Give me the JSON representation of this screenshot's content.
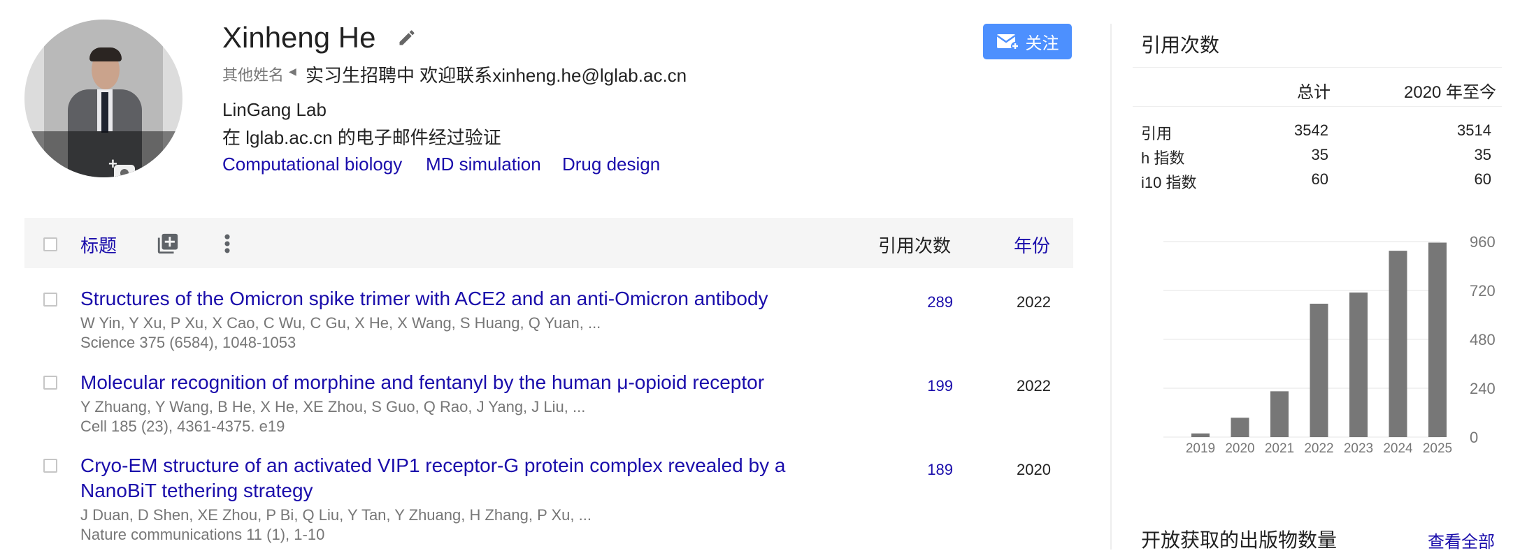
{
  "profile": {
    "name": "Xinheng He",
    "other_names_label": "其他姓名",
    "other_names_value": "实习生招聘中 欢迎联系xinheng.he@lglab.ac.cn",
    "affiliation": "LinGang Lab",
    "verified_email": "在 lglab.ac.cn 的电子邮件经过验证",
    "interests": [
      "Computational biology",
      "MD simulation",
      "Drug design"
    ],
    "follow_label": "关注"
  },
  "table": {
    "title_header": "标题",
    "cited_header": "引用次数",
    "year_header": "年份",
    "rows": [
      {
        "title_lines": [
          "Structures of the Omicron spike trimer with ACE2 and an anti-Omicron antibody"
        ],
        "authors": "W Yin, Y Xu, P Xu, X Cao, C Wu, C Gu, X He, X Wang, S Huang, Q Yuan, ...",
        "venue": "Science 375 (6584), 1048-1053",
        "cited": "289",
        "year": "2022"
      },
      {
        "title_lines": [
          "Molecular recognition of morphine and fentanyl by the human μ-opioid receptor"
        ],
        "authors": "Y Zhuang, Y Wang, B He, X He, XE Zhou, S Guo, Q Rao, J Yang, J Liu, ...",
        "venue": "Cell 185 (23), 4361-4375. e19",
        "cited": "199",
        "year": "2022"
      },
      {
        "title_lines": [
          "Cryo-EM structure of an activated VIP1 receptor-G protein complex revealed by a",
          "NanoBiT tethering strategy"
        ],
        "authors": "J Duan, D Shen, XE Zhou, P Bi, Q Liu, Y Tan, Y Zhuang, H Zhang, P Xu, ...",
        "venue": "Nature communications 11 (1), 1-10",
        "cited": "189",
        "year": "2020"
      }
    ]
  },
  "citations": {
    "title": "引用次数",
    "col_total": "总计",
    "col_since": "2020 年至今",
    "metrics": [
      {
        "label": "引用",
        "total": "3542",
        "since": "3514"
      },
      {
        "label": "h 指数",
        "total": "35",
        "since": "35"
      },
      {
        "label": "i10 指数",
        "total": "60",
        "since": "60"
      }
    ]
  },
  "chart_data": {
    "type": "bar",
    "categories": [
      "2019",
      "2020",
      "2021",
      "2022",
      "2023",
      "2024",
      "2025"
    ],
    "values": [
      18,
      95,
      225,
      655,
      710,
      915,
      955
    ],
    "yticks": [
      0,
      240,
      480,
      720,
      960
    ],
    "ylim": [
      0,
      960
    ],
    "title": "",
    "xlabel": "",
    "ylabel": "",
    "bar_color": "#777777",
    "grid": true
  },
  "open_access": {
    "title": "开放获取的出版物数量",
    "view_all": "查看全部"
  },
  "colors": {
    "link": "#1a0dab",
    "follow_button": "#4d90fe"
  }
}
